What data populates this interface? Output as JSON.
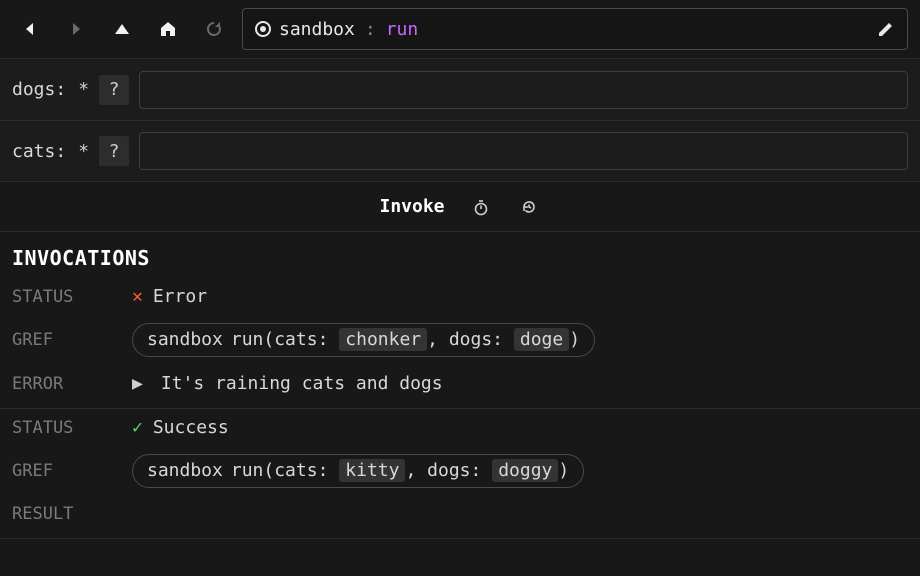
{
  "toolbar": {
    "address": {
      "namespace": "sandbox",
      "sep": ":",
      "command": "run"
    }
  },
  "params": [
    {
      "label": "dogs:",
      "required": "*",
      "help": "?",
      "value": ""
    },
    {
      "label": "cats:",
      "required": "*",
      "help": "?",
      "value": ""
    }
  ],
  "invoke": {
    "label": "Invoke"
  },
  "invocations": {
    "title": "INVOCATIONS",
    "labels": {
      "status": "STATUS",
      "gref": "GREF",
      "error": "ERROR",
      "result": "RESULT"
    },
    "items": [
      {
        "status_text": "Error",
        "status_kind": "error",
        "gref": {
          "ns": "sandbox",
          "func": "run",
          "args": [
            {
              "name": "cats",
              "value": "chonker"
            },
            {
              "name": "dogs",
              "value": "doge"
            }
          ]
        },
        "detail_label": "ERROR",
        "detail_text": "It's raining cats and dogs"
      },
      {
        "status_text": "Success",
        "status_kind": "success",
        "gref": {
          "ns": "sandbox",
          "func": "run",
          "args": [
            {
              "name": "cats",
              "value": "kitty"
            },
            {
              "name": "dogs",
              "value": "doggy"
            }
          ]
        },
        "detail_label": "RESULT",
        "detail_text": ""
      }
    ]
  }
}
